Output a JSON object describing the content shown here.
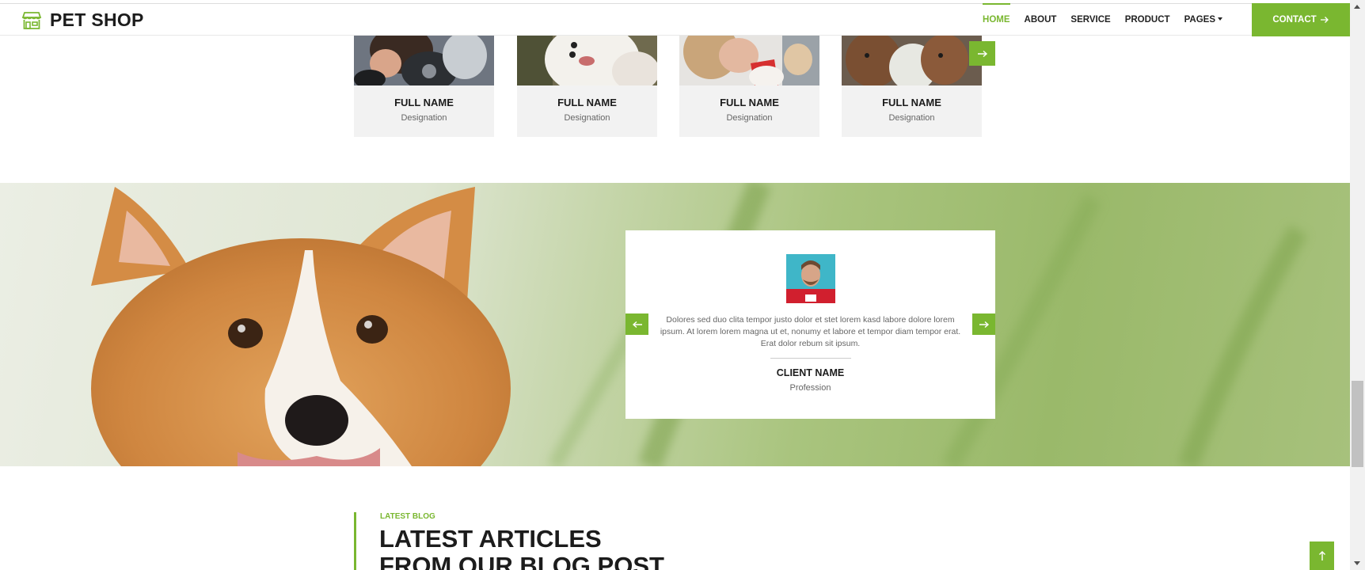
{
  "brand": {
    "name": "PET SHOP"
  },
  "nav": {
    "links": [
      "HOME",
      "ABOUT",
      "SERVICE",
      "PRODUCT",
      "PAGES"
    ],
    "active": "HOME",
    "contact_label": "CONTACT"
  },
  "team": {
    "members": [
      {
        "name": "FULL NAME",
        "role": "Designation"
      },
      {
        "name": "FULL NAME",
        "role": "Designation"
      },
      {
        "name": "FULL NAME",
        "role": "Designation"
      },
      {
        "name": "FULL NAME",
        "role": "Designation"
      }
    ]
  },
  "testimonial": {
    "text": "Dolores sed duo clita tempor justo dolor et stet lorem kasd labore dolore lorem ipsum. At lorem lorem magna ut et, nonumy et labore et tempor diam tempor erat. Erat dolor rebum sit ipsum.",
    "name": "CLIENT NAME",
    "profession": "Profession"
  },
  "blog": {
    "subtitle": "LATEST BLOG",
    "title": "LATEST ARTICLES FROM OUR BLOG POST"
  },
  "colors": {
    "accent": "#7ab730",
    "text": "#1c1c1c",
    "muted": "#666666"
  }
}
